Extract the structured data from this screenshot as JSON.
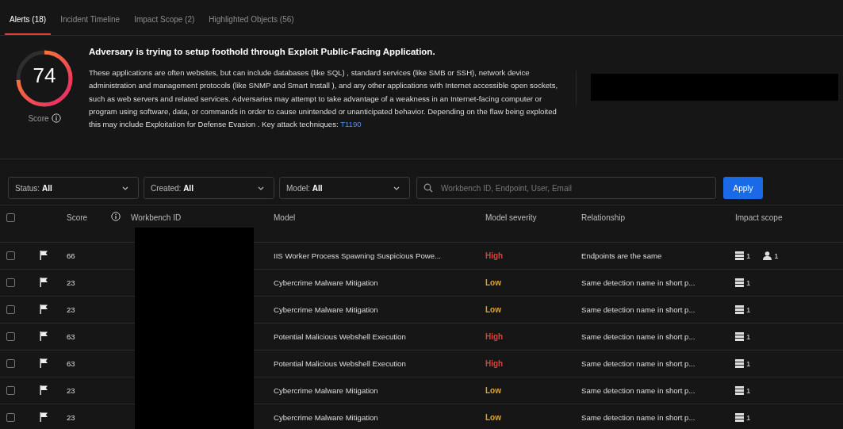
{
  "tabs": [
    {
      "label": "Alerts (18)",
      "selected": true
    },
    {
      "label": "Incident Timeline",
      "selected": false
    },
    {
      "label": "Impact Scope (2)",
      "selected": false
    },
    {
      "label": "Highlighted Objects (56)",
      "selected": false
    }
  ],
  "summary": {
    "score": "74",
    "score_label": "Score",
    "title": "Adversary is trying to setup foothold through Exploit Public-Facing Application.",
    "description": "These applications are often websites, but can include databases (like SQL) , standard services (like SMB or SSH), network device administration and management protocols (like SNMP and Smart Install ), and any other applications with Internet accessible open sockets, such as web servers and related services. Adversaries may attempt to take advantage of a weakness in an Internet-facing computer or program using software, data, or commands in order to cause unintended or unanticipated behavior. Depending on the flaw being exploited this may include Exploitation for Defense Evasion . Key attack techniques:",
    "technique_link": "T1190"
  },
  "filters": [
    {
      "label": "Status:",
      "value": "All"
    },
    {
      "label": "Created:",
      "value": "All"
    },
    {
      "label": "Model:",
      "value": "All"
    }
  ],
  "search": {
    "placeholder": "Workbench ID, Endpoint, User, Email"
  },
  "apply_button": "Apply",
  "table": {
    "select_all_checked": false,
    "columns": [
      "Score",
      "Workbench ID",
      "Model",
      "Model severity",
      "Relationship",
      "Impact scope"
    ],
    "rows": [
      {
        "checked": false,
        "score": "66",
        "model": "IIS Worker Process Spawning Suspicious Powe...",
        "severity": "High",
        "color": "#d9413a",
        "relationship": "Endpoints are the same",
        "impact": [
          {
            "kind": "endpoint",
            "count": "1"
          },
          {
            "kind": "user",
            "count": "1"
          }
        ]
      },
      {
        "checked": false,
        "score": "23",
        "model": "Cybercrime Malware Mitigation",
        "severity": "Low",
        "color": "#e0a526",
        "relationship": "Same detection name in short p...",
        "impact": [
          {
            "kind": "endpoint",
            "count": "1"
          }
        ]
      },
      {
        "checked": false,
        "score": "23",
        "model": "Cybercrime Malware Mitigation",
        "severity": "Low",
        "color": "#e0a526",
        "relationship": "Same detection name in short p...",
        "impact": [
          {
            "kind": "endpoint",
            "count": "1"
          }
        ]
      },
      {
        "checked": false,
        "score": "63",
        "model": "Potential Malicious Webshell Execution",
        "severity": "High",
        "color": "#d9413a",
        "relationship": "Same detection name in short p...",
        "impact": [
          {
            "kind": "endpoint",
            "count": "1"
          }
        ]
      },
      {
        "checked": false,
        "score": "63",
        "model": "Potential Malicious Webshell Execution",
        "severity": "High",
        "color": "#d9413a",
        "relationship": "Same detection name in short p...",
        "impact": [
          {
            "kind": "endpoint",
            "count": "1"
          }
        ]
      },
      {
        "checked": false,
        "score": "23",
        "model": "Cybercrime Malware Mitigation",
        "severity": "Low",
        "color": "#e0a526",
        "relationship": "Same detection name in short p...",
        "impact": [
          {
            "kind": "endpoint",
            "count": "1"
          }
        ]
      },
      {
        "checked": false,
        "score": "23",
        "model": "Cybercrime Malware Mitigation",
        "severity": "Low",
        "color": "#e0a526",
        "relationship": "Same detection name in short p...",
        "impact": [
          {
            "kind": "endpoint",
            "count": "1"
          }
        ]
      }
    ]
  }
}
